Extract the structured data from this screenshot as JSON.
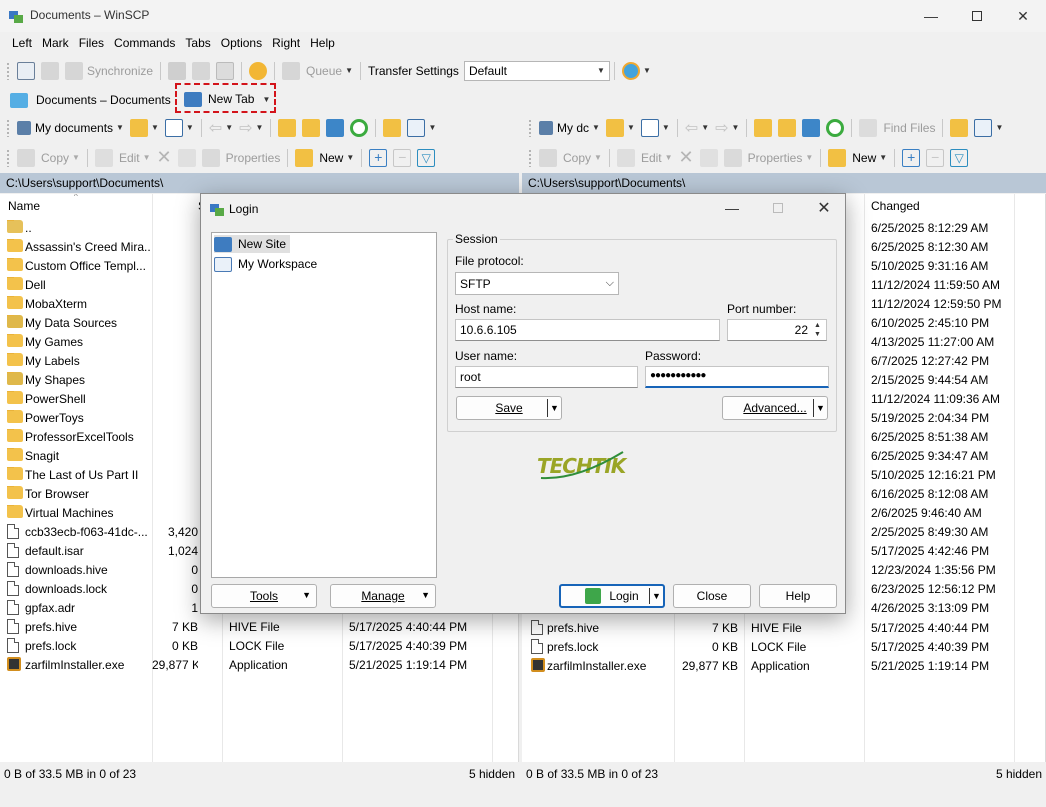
{
  "window": {
    "title": "Documents – WinSCP"
  },
  "menu": [
    "Left",
    "Mark",
    "Files",
    "Commands",
    "Tabs",
    "Options",
    "Right",
    "Help"
  ],
  "main_toolbar": {
    "synchronize": "Synchronize",
    "queue": "Queue",
    "transfer_settings_label": "Transfer Settings",
    "transfer_settings_value": "Default"
  },
  "tabs": [
    {
      "label": "Documents – Documents"
    },
    {
      "label": "New Tab"
    }
  ],
  "left_panel": {
    "location": "My documents",
    "path": "C:\\Users\\support\\Documents\\",
    "toolbar": {
      "copy": "Copy",
      "edit": "Edit",
      "properties": "Properties",
      "new": "New"
    },
    "columns": {
      "name": "Name",
      "size": "S"
    },
    "files": [
      {
        "name": "..",
        "size": "",
        "type": "",
        "changed": "",
        "icon": "parent"
      },
      {
        "name": "Assassin's Creed Mira...",
        "size": "",
        "type": "",
        "changed": "",
        "icon": "folder"
      },
      {
        "name": "Custom Office Templ...",
        "size": "",
        "type": "",
        "changed": "",
        "icon": "folder"
      },
      {
        "name": "Dell",
        "size": "",
        "type": "",
        "changed": "",
        "icon": "folder"
      },
      {
        "name": "MobaXterm",
        "size": "",
        "type": "",
        "changed": "",
        "icon": "folder"
      },
      {
        "name": "My Data Sources",
        "size": "",
        "type": "",
        "changed": "",
        "icon": "folder-special"
      },
      {
        "name": "My Games",
        "size": "",
        "type": "",
        "changed": "",
        "icon": "folder"
      },
      {
        "name": "My Labels",
        "size": "",
        "type": "",
        "changed": "",
        "icon": "folder"
      },
      {
        "name": "My Shapes",
        "size": "",
        "type": "",
        "changed": "",
        "icon": "folder-special"
      },
      {
        "name": "PowerShell",
        "size": "",
        "type": "",
        "changed": "",
        "icon": "folder"
      },
      {
        "name": "PowerToys",
        "size": "",
        "type": "",
        "changed": "",
        "icon": "folder"
      },
      {
        "name": "ProfessorExcelTools",
        "size": "",
        "type": "",
        "changed": "",
        "icon": "folder"
      },
      {
        "name": "Snagit",
        "size": "",
        "type": "",
        "changed": "",
        "icon": "folder"
      },
      {
        "name": "The Last of Us Part II",
        "size": "",
        "type": "",
        "changed": "",
        "icon": "folder"
      },
      {
        "name": "Tor Browser",
        "size": "",
        "type": "",
        "changed": "",
        "icon": "folder"
      },
      {
        "name": "Virtual Machines",
        "size": "",
        "type": "",
        "changed": "",
        "icon": "folder"
      },
      {
        "name": "ccb33ecb-f063-41dc-...",
        "size": "3,420",
        "type": "",
        "changed": "",
        "icon": "file"
      },
      {
        "name": "default.isar",
        "size": "1,024",
        "type": "",
        "changed": "",
        "icon": "file"
      },
      {
        "name": "downloads.hive",
        "size": "0",
        "type": "",
        "changed": "",
        "icon": "file"
      },
      {
        "name": "downloads.lock",
        "size": "0",
        "type": "",
        "changed": "",
        "icon": "file"
      },
      {
        "name": "gpfax.adr",
        "size": "1",
        "type": "",
        "changed": "",
        "icon": "file"
      },
      {
        "name": "prefs.hive",
        "size": "7 KB",
        "type": "HIVE File",
        "changed": "5/17/2025 4:40:44 PM",
        "icon": "file"
      },
      {
        "name": "prefs.lock",
        "size": "0 KB",
        "type": "LOCK File",
        "changed": "5/17/2025 4:40:39 PM",
        "icon": "file"
      },
      {
        "name": "zarfilmInstaller.exe",
        "size": "29,877 KB",
        "type": "Application",
        "changed": "5/21/2025 1:19:14 PM",
        "icon": "exe"
      }
    ],
    "status": "0 B of 33.5 MB in 0 of 23",
    "hidden": "5 hidden"
  },
  "right_panel": {
    "location": "My dc",
    "path": "C:\\Users\\support\\Documents\\",
    "toolbar": {
      "find_files": "Find Files",
      "copy": "Copy",
      "edit": "Edit",
      "properties": "Properties",
      "new": "New"
    },
    "columns": {
      "changed": "Changed"
    },
    "changed_dates": [
      "6/25/2025 8:12:29 AM",
      "6/25/2025 8:12:30 AM",
      "5/10/2025 9:31:16 AM",
      "11/12/2024 11:59:50 AM",
      "11/12/2024 12:59:50 PM",
      "6/10/2025 2:45:10 PM",
      "4/13/2025 11:27:00 AM",
      "6/7/2025 12:27:42 PM",
      "2/15/2025 9:44:54 AM",
      "11/12/2024 11:09:36 AM",
      "5/19/2025 2:04:34 PM",
      "6/25/2025 8:51:38 AM",
      "6/25/2025 9:34:47 AM",
      "5/10/2025 12:16:21 PM",
      "6/16/2025 8:12:08 AM",
      "2/6/2025 9:46:40 AM",
      "2/25/2025 8:49:30 AM",
      "5/17/2025 4:42:46 PM",
      "12/23/2024 1:35:56 PM",
      "6/23/2025 12:56:12 PM",
      "4/26/2025 3:13:09 PM"
    ],
    "bottom_files": [
      {
        "name": "prefs.hive",
        "size": "7 KB",
        "type": "HIVE File",
        "changed": "5/17/2025 4:40:44 PM"
      },
      {
        "name": "prefs.lock",
        "size": "0 KB",
        "type": "LOCK File",
        "changed": "5/17/2025 4:40:39 PM"
      },
      {
        "name": "zarfilmInstaller.exe",
        "size": "29,877 KB",
        "type": "Application",
        "changed": "5/21/2025 1:19:14 PM"
      }
    ],
    "status": "0 B of 33.5 MB in 0 of 23",
    "hidden": "5 hidden"
  },
  "login": {
    "title": "Login",
    "sites": [
      "New Site",
      "My Workspace"
    ],
    "session_label": "Session",
    "file_protocol_label": "File protocol:",
    "file_protocol_value": "SFTP",
    "host_name_label": "Host name:",
    "host_name_value": "10.6.6.105",
    "port_label": "Port number:",
    "port_value": "22",
    "user_name_label": "User name:",
    "user_name_value": "root",
    "password_label": "Password:",
    "password_value": "●●●●●●●●●●●",
    "save": "Save",
    "advanced": "Advanced...",
    "logo_text": "TECHTIK",
    "tools": "Tools",
    "manage": "Manage",
    "login_button": "Login",
    "close": "Close",
    "help": "Help"
  }
}
